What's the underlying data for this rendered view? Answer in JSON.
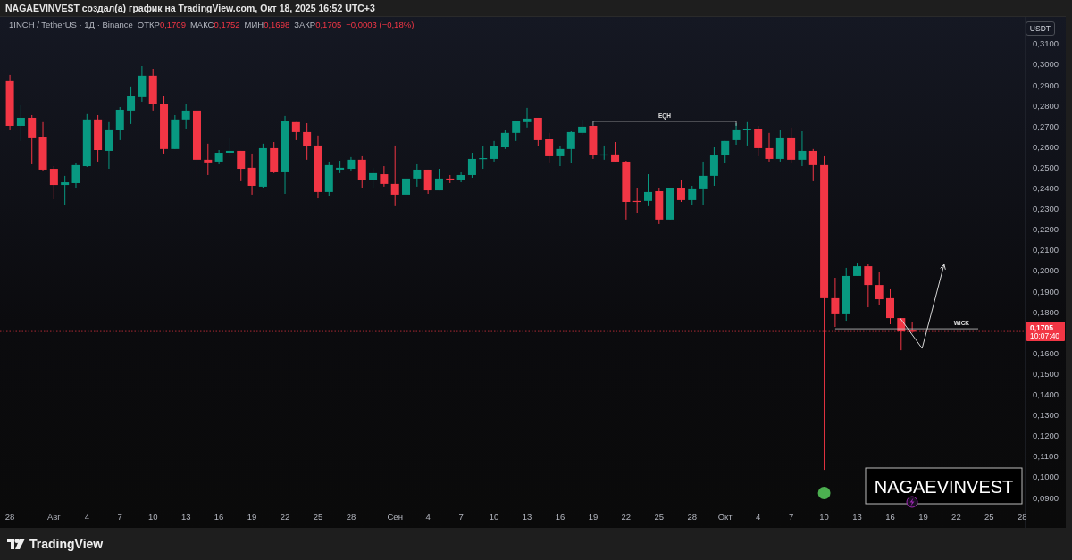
{
  "header": {
    "text": "NAGAEVINVEST создал(а) график на TradingView.com, Окт 18, 2025 16:52 UTC+3"
  },
  "legend": {
    "symbol": "1INCH / TetherUS · 1Д · Binance",
    "fields": [
      {
        "label": "ОТКР",
        "value": "0,1709"
      },
      {
        "label": "МАКС",
        "value": "0,1752"
      },
      {
        "label": "МИН",
        "value": "0,1698"
      },
      {
        "label": "ЗАКР",
        "value": "0,1705"
      }
    ],
    "change": "−0,0003 (−0,18%)"
  },
  "currency": "USDT",
  "chart": {
    "price_axis": [
      "0,3100",
      "0,3000",
      "0,2900",
      "0,2800",
      "0,2700",
      "0,2600",
      "0,2500",
      "0,2400",
      "0,2300",
      "0,2200",
      "0,2100",
      "0,2000",
      "0,1900",
      "0,1800",
      "0,1600",
      "0,1500",
      "0,1400",
      "0,1300",
      "0,1200",
      "0,1100",
      "0,1000",
      "0,0900"
    ],
    "date_axis": [
      "28",
      "Авг",
      "4",
      "7",
      "10",
      "13",
      "16",
      "19",
      "22",
      "25",
      "28",
      "Сен",
      "4",
      "7",
      "10",
      "13",
      "16",
      "19",
      "22",
      "25",
      "28",
      "Окт",
      "4",
      "7",
      "10",
      "13",
      "16",
      "19",
      "22",
      "25",
      "28"
    ],
    "annotations": [
      {
        "kind": "level",
        "label": "EQH"
      },
      {
        "kind": "level",
        "label": "WICK"
      },
      {
        "kind": "arrow"
      }
    ],
    "price_tag": {
      "price": "0,1705",
      "countdown": "10:07:40"
    },
    "author_badge": "NAGAEVINVEST"
  },
  "footer": {
    "brand": "TradingView"
  }
}
